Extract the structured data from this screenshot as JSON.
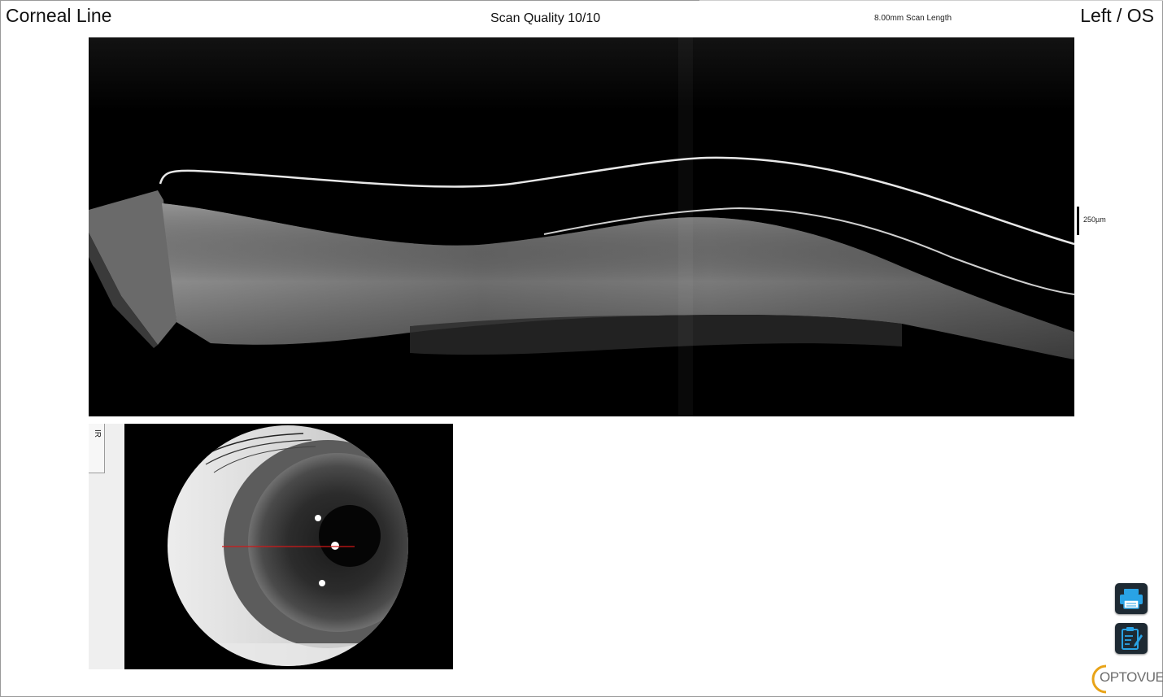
{
  "header": {
    "title": "Corneal Line",
    "scan_quality": "Scan Quality 10/10",
    "scan_length": "8.00mm Scan Length",
    "eye_side": "Left / OS"
  },
  "bscan": {
    "scale_label": "250µm"
  },
  "ir_panel": {
    "tab_label": "IR"
  },
  "actions": {
    "print_icon": "printer-icon",
    "notes_icon": "clipboard-edit-icon"
  },
  "brand": {
    "logo_text": "OPTOVUE",
    "accent_color": "#e8a317"
  },
  "colors": {
    "scan_line": "#d01818",
    "button_bg": "#1e2a33",
    "icon_blue": "#29a3e6"
  }
}
